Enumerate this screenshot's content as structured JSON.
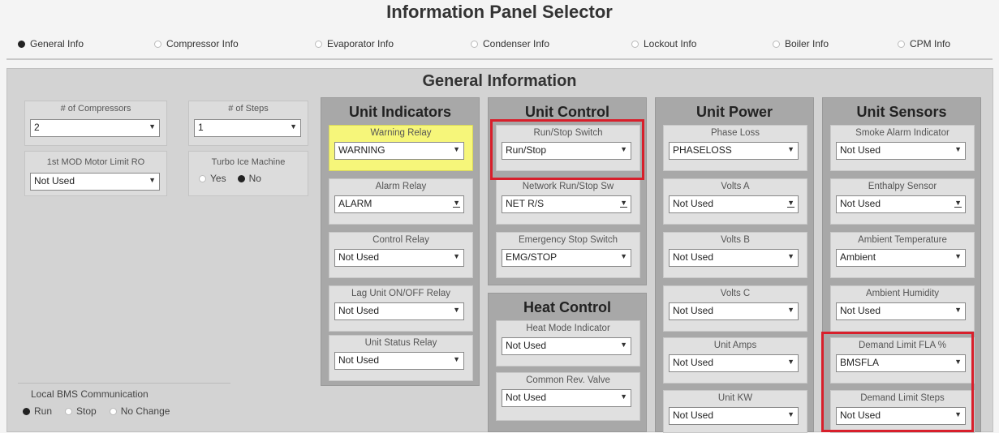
{
  "selector": {
    "title": "Information Panel Selector",
    "options": [
      {
        "label": "General Info",
        "selected": true
      },
      {
        "label": "Compressor Info",
        "selected": false
      },
      {
        "label": "Evaporator Info",
        "selected": false
      },
      {
        "label": "Condenser Info",
        "selected": false
      },
      {
        "label": "Lockout Info",
        "selected": false
      },
      {
        "label": "Boiler Info",
        "selected": false
      },
      {
        "label": "CPM Info",
        "selected": false
      }
    ]
  },
  "main": {
    "title": "General Information"
  },
  "left": {
    "compressors": {
      "label": "# of Compressors",
      "value": "2"
    },
    "steps": {
      "label": "# of Steps",
      "value": "1"
    },
    "first_mod": {
      "label": "1st MOD Motor Limit RO",
      "value": "Not Used"
    },
    "turbo": {
      "label": "Turbo Ice Machine",
      "yes": "Yes",
      "no": "No",
      "selected": "No"
    },
    "bms": {
      "label": "Local BMS Communication",
      "run": "Run",
      "stop": "Stop",
      "nochange": "No Change",
      "selected": "Run"
    }
  },
  "columns": {
    "indicators": {
      "title": "Unit Indicators",
      "cards": [
        {
          "label": "Warning Relay",
          "value": "WARNING",
          "highlight_bg": "#f6f67a"
        },
        {
          "label": "Alarm Relay",
          "value": "ALARM"
        },
        {
          "label": "Control Relay",
          "value": "Not Used"
        },
        {
          "label": "Lag Unit ON/OFF Relay",
          "value": "Not Used"
        },
        {
          "label": "Unit Status Relay",
          "value": "Not Used"
        }
      ]
    },
    "control": {
      "title": "Unit Control",
      "cards": [
        {
          "label": "Run/Stop Switch",
          "value": "Run/Stop"
        },
        {
          "label": "Network Run/Stop Sw",
          "value": "NET R/S"
        },
        {
          "label": "Emergency Stop Switch",
          "value": "EMG/STOP"
        }
      ]
    },
    "heat": {
      "title": "Heat Control",
      "cards": [
        {
          "label": "Heat Mode Indicator",
          "value": "Not Used"
        },
        {
          "label": "Common Rev. Valve",
          "value": "Not Used"
        }
      ]
    },
    "power": {
      "title": "Unit Power",
      "cards": [
        {
          "label": "Phase Loss",
          "value": "PHASELOSS"
        },
        {
          "label": "Volts A",
          "value": "Not Used"
        },
        {
          "label": "Volts B",
          "value": "Not Used"
        },
        {
          "label": "Volts C",
          "value": "Not Used"
        },
        {
          "label": "Unit Amps",
          "value": "Not Used"
        },
        {
          "label": "Unit KW",
          "value": "Not Used"
        }
      ]
    },
    "sensors": {
      "title": "Unit Sensors",
      "cards": [
        {
          "label": "Smoke Alarm Indicator",
          "value": "Not Used"
        },
        {
          "label": "Enthalpy Sensor",
          "value": "Not Used"
        },
        {
          "label": "Ambient Temperature",
          "value": "Ambient"
        },
        {
          "label": "Ambient Humidity",
          "value": "Not Used"
        },
        {
          "label": "Demand Limit FLA %",
          "value": "BMSFLA"
        },
        {
          "label": "Demand Limit Steps",
          "value": "Not Used"
        }
      ]
    }
  },
  "colors": {
    "highlight": "#d81f2b",
    "warning_yellow": "#f6f67a"
  }
}
